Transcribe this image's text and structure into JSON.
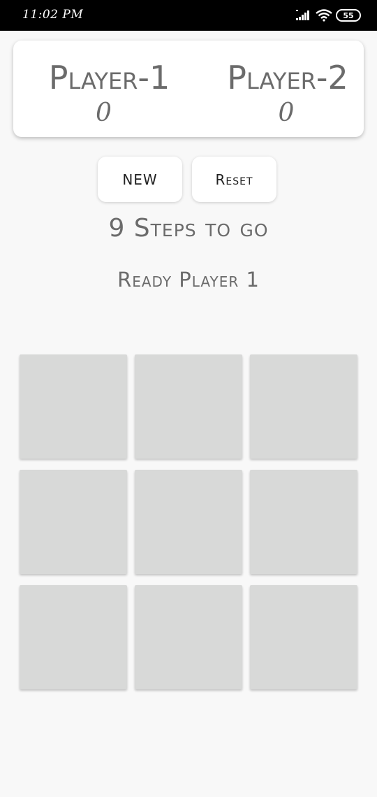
{
  "status_bar": {
    "time": "11:02 PM",
    "battery": "55",
    "icons": [
      "signal-icon",
      "wifi-icon",
      "battery-icon"
    ]
  },
  "scoreboard": {
    "player1": {
      "name": "Player-1",
      "score": "0"
    },
    "player2": {
      "name": "Player-2",
      "score": "0"
    }
  },
  "controls": {
    "new_label": "NEW",
    "reset_label": "Reset"
  },
  "status": {
    "steps": "9 Steps to go",
    "turn": "Ready Player 1"
  },
  "board": {
    "cells": [
      "",
      "",
      "",
      "",
      "",
      "",
      "",
      "",
      ""
    ]
  },
  "colors": {
    "background": "#f8f8f8",
    "cell": "#d8d9d8",
    "text": "#6b6b6b",
    "status_bar": "#000000"
  }
}
